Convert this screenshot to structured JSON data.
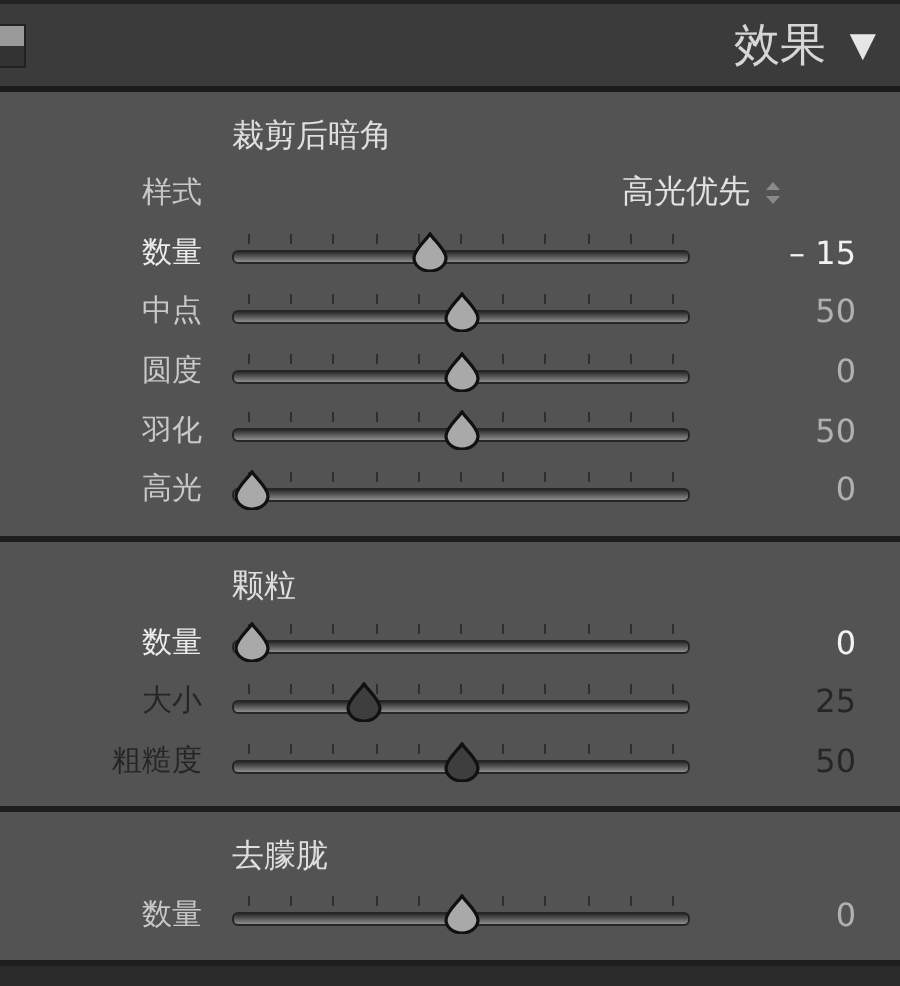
{
  "header": {
    "title": "效果",
    "toggle": "▼"
  },
  "sections": [
    {
      "title": "裁剪后暗角",
      "rows": [
        {
          "kind": "select",
          "label": "样式",
          "value": "高光优先"
        },
        {
          "kind": "slider",
          "label": "数量",
          "level": 0.425,
          "reading": "– 15",
          "active": true,
          "disabled": false
        },
        {
          "kind": "slider",
          "label": "中点",
          "level": 0.5,
          "reading": "50",
          "active": false,
          "disabled": false
        },
        {
          "kind": "slider",
          "label": "圆度",
          "level": 0.5,
          "reading": "0",
          "active": false,
          "disabled": false
        },
        {
          "kind": "slider",
          "label": "羽化",
          "level": 0.5,
          "reading": "50",
          "active": false,
          "disabled": false
        },
        {
          "kind": "slider",
          "label": "高光",
          "level": 0.0,
          "reading": "0",
          "active": false,
          "disabled": false
        }
      ]
    },
    {
      "title": "颗粒",
      "rows": [
        {
          "kind": "slider",
          "label": "数量",
          "level": 0.0,
          "reading": "0",
          "active": true,
          "disabled": false
        },
        {
          "kind": "slider",
          "label": "大小",
          "level": 0.27,
          "reading": "25",
          "active": false,
          "disabled": true
        },
        {
          "kind": "slider",
          "label": "粗糙度",
          "level": 0.5,
          "reading": "50",
          "active": false,
          "disabled": true
        }
      ]
    },
    {
      "title": "去朦胧",
      "rows": [
        {
          "kind": "slider",
          "label": "数量",
          "level": 0.5,
          "reading": "0",
          "active": false,
          "disabled": false
        }
      ]
    }
  ]
}
